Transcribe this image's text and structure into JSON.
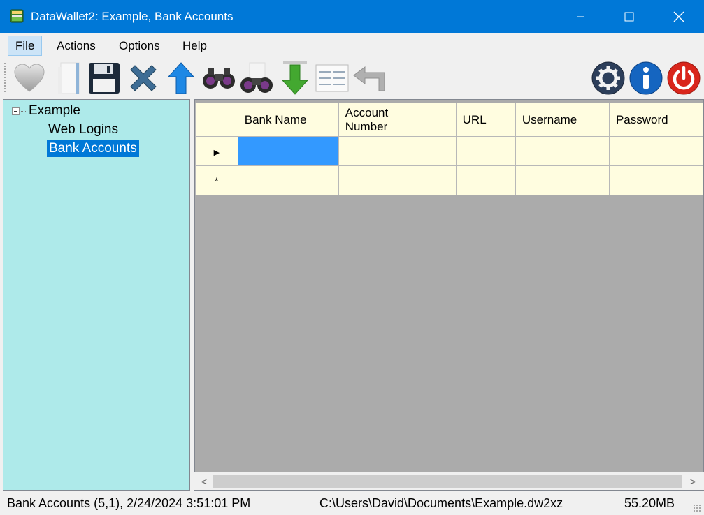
{
  "window": {
    "title": "DataWallet2: Example, Bank Accounts"
  },
  "menu": {
    "items": [
      "File",
      "Actions",
      "Options",
      "Help"
    ],
    "active": "File"
  },
  "toolbar": {
    "buttons": [
      "favorite-icon",
      "new-icon",
      "save-icon",
      "delete-icon",
      "up-icon",
      "find-icon",
      "find-next-icon",
      "download-icon",
      "list-view-icon",
      "undo-icon",
      "settings-icon",
      "info-icon",
      "power-icon"
    ]
  },
  "tree": {
    "root": "Example",
    "children": [
      "Web Logins",
      "Bank Accounts"
    ],
    "selected": "Bank Accounts"
  },
  "grid": {
    "columns": [
      "Bank Name",
      "Account Number",
      "URL",
      "Username",
      "Password"
    ],
    "column_header_lines": {
      "account_number": [
        "Account",
        "Number"
      ]
    },
    "row_markers": {
      "current": "▶",
      "new": "*"
    }
  },
  "statusbar": {
    "location": "Bank Accounts (5,1), 2/24/2024 3:51:01 PM",
    "path": "C:\\Users\\David\\Documents\\Example.dw2xz",
    "size": "55.20MB"
  },
  "scrollbar": {
    "left_arrow": "<",
    "right_arrow": ">"
  },
  "colors": {
    "titlebar": "#0078d7",
    "tree_background": "#aeeaea",
    "grid_cell": "#fffde0",
    "grid_empty": "#ababab",
    "selection": "#3399ff"
  }
}
